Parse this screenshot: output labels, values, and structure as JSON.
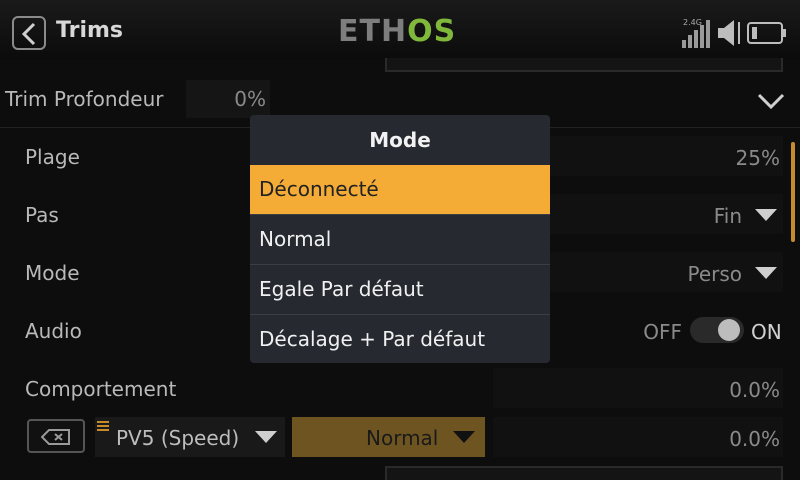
{
  "header": {
    "title": "Trims",
    "logo_eth": "ETH",
    "logo_os": "OS",
    "band": "2.4G",
    "icons": [
      "back-icon",
      "signal-icon",
      "speaker-icon",
      "battery-icon"
    ]
  },
  "trim": {
    "label": "Trim Profondeur",
    "value": "0%"
  },
  "rows": {
    "plage": {
      "label": "Plage",
      "value": "25%"
    },
    "pas": {
      "label": "Pas",
      "value": "Fin"
    },
    "mode": {
      "label": "Mode",
      "value": "Perso"
    },
    "audio": {
      "label": "Audio",
      "off": "OFF",
      "on": "ON",
      "state": "on"
    },
    "comportement": {
      "label": "Comportement",
      "value": "0.0%"
    }
  },
  "bottom_row": {
    "source": "PV5 (Speed)",
    "mode": "Normal",
    "value": "0.0%"
  },
  "modal": {
    "title": "Mode",
    "options": [
      "Déconnecté",
      "Normal",
      "Egale Par défaut",
      "Décalage + Par défaut"
    ],
    "selected_index": 0
  },
  "colors": {
    "accent": "#f5ac37",
    "logo_green": "#7fb83a",
    "modal_bg": "#262a30"
  }
}
